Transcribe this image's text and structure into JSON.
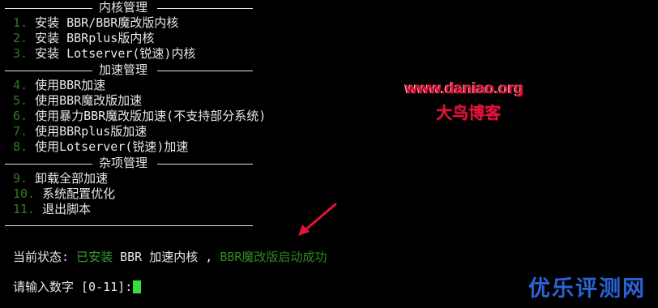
{
  "sections": [
    {
      "title": "内核管理",
      "items": [
        {
          "num": "1.",
          "label": "安装 BBR/BBR魔改版内核"
        },
        {
          "num": "2.",
          "label": "安装 BBRplus版内核"
        },
        {
          "num": "3.",
          "label": "安装 Lotserver(锐速)内核"
        }
      ]
    },
    {
      "title": "加速管理",
      "items": [
        {
          "num": "4.",
          "label": "使用BBR加速"
        },
        {
          "num": "5.",
          "label": "使用BBR魔改版加速"
        },
        {
          "num": "6.",
          "label": "使用暴力BBR魔改版加速(不支持部分系统)"
        },
        {
          "num": "7.",
          "label": "使用BBRplus版加速"
        },
        {
          "num": "8.",
          "label": "使用Lotserver(锐速)加速"
        }
      ]
    },
    {
      "title": "杂项管理",
      "items": [
        {
          "num": "9.",
          "label": "卸载全部加速"
        },
        {
          "num": "10.",
          "label": "系统配置优化"
        },
        {
          "num": "11.",
          "label": "退出脚本"
        }
      ]
    }
  ],
  "status": {
    "label": "当前状态:",
    "installed": "已安装",
    "kernel": "BBR 加速内核 ,",
    "running": "BBR魔改版启动成功"
  },
  "prompt": {
    "text": "请输入数字 [0-11]:"
  },
  "watermarks": {
    "url": "www.daniao.org",
    "blog_name": "大鸟博客",
    "corner_logo": "优乐评测网"
  },
  "colors": {
    "background": "#000000",
    "text": "#e6e6e6",
    "number": "#2f7d1e",
    "status_green": "#35a12a",
    "cursor": "#34e03c",
    "watermark_red": "#e0153a",
    "logo_blue": "#2a63d6"
  }
}
